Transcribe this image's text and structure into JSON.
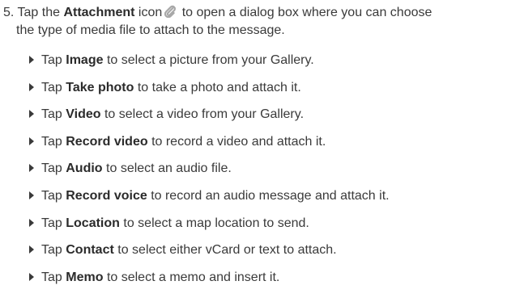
{
  "step": {
    "number": "5.",
    "intro": "Tap the",
    "bold": "Attachment",
    "after_bold": "icon",
    "rest_line1": "to open a dialog box where you can choose",
    "line2": "the type of media file to attach to the message.",
    "icon": "paperclip-icon"
  },
  "items": [
    {
      "pre": "Tap",
      "bold": "Image",
      "post": "to select a picture from your Gallery."
    },
    {
      "pre": "Tap",
      "bold": "Take photo",
      "post": "to take a photo and attach it."
    },
    {
      "pre": "Tap",
      "bold": "Video",
      "post": "to select a video from your Gallery."
    },
    {
      "pre": "Tap",
      "bold": "Record video",
      "post": "to record a video and attach it."
    },
    {
      "pre": "Tap",
      "bold": "Audio",
      "post": "to select an audio file."
    },
    {
      "pre": "Tap",
      "bold": "Record voice",
      "post": "to record an audio message and attach it."
    },
    {
      "pre": "Tap",
      "bold": "Location",
      "post": "to select a map location to send."
    },
    {
      "pre": "Tap",
      "bold": "Contact",
      "post": "to select either vCard or text to attach."
    },
    {
      "pre": "Tap",
      "bold": "Memo",
      "post": "to select a memo and insert it."
    }
  ],
  "colors": {
    "text": "#3a3a3a",
    "bold_text": "#2b2b2b",
    "icon": "#a8a8a8"
  }
}
